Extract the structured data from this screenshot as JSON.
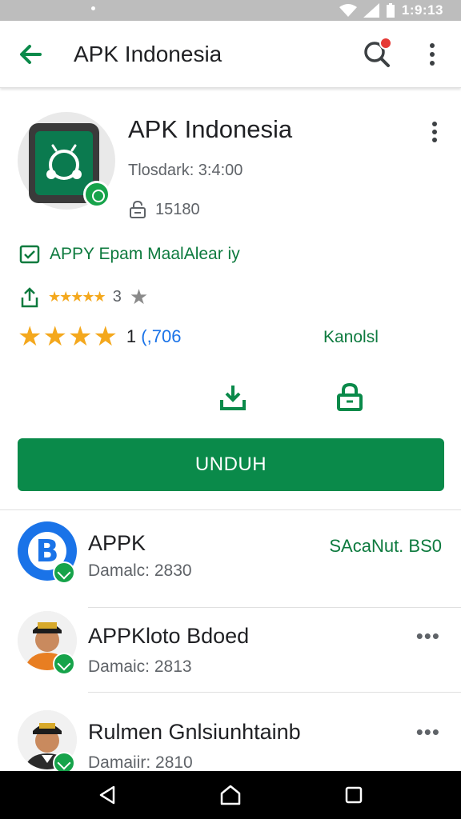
{
  "status_bar": {
    "time": "1:9:13"
  },
  "app_bar": {
    "title": "APK Indonesia",
    "icons": [
      "back-arrow-icon",
      "search-icon",
      "more-vert-icon"
    ]
  },
  "app": {
    "name": "APK Indonesia",
    "subtitle": "Tlosdark: 3:4:00",
    "size": "15180",
    "verified_label": "APPY Epam MaalAlear iy",
    "share_rating": "3",
    "rating_count_prefix": "1 ",
    "rating_count_suffix": "(,706",
    "rating_stars": 4,
    "rating_right_label": "Kanolsl",
    "install_label": "UNDUH"
  },
  "related": [
    {
      "title": "APPK",
      "subtitle": "Damalc: 2830",
      "action": "SAcaNut. BS0",
      "avatar": "blue-logo"
    },
    {
      "title": "APPKloto Bdoed",
      "subtitle": "Damaic: 2813",
      "action": "•••",
      "avatar": "person"
    },
    {
      "title": "Rulmen Gnlsiunhtainb",
      "subtitle": "Damaiir: 2810",
      "action": "•••",
      "avatar": "person"
    }
  ],
  "colors": {
    "accent_green": "#0a8a4a",
    "star": "#f4a81d",
    "brand_blue": "#1a73e8"
  }
}
